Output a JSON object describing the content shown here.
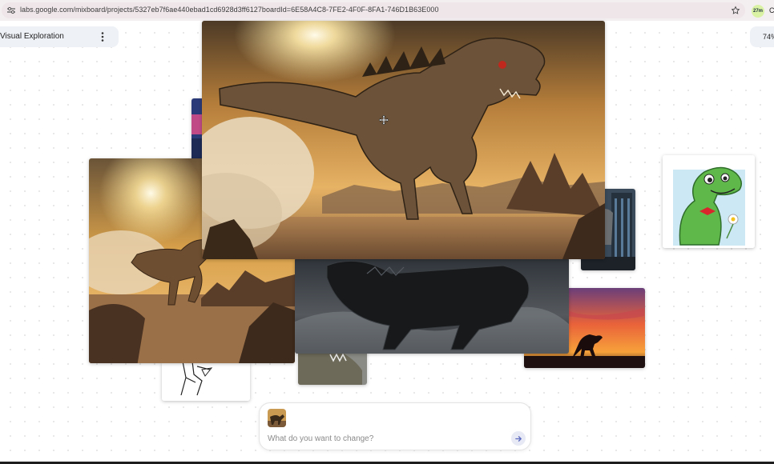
{
  "browser": {
    "url": "labs.google.com/mixboard/projects/5327eb7f6ae440ebad1cd6928d3ff6127boardId=6E58A4C8-7FE2-4F0F-8FA1-746D1B63E000",
    "extension_badge": "27m",
    "edge_char": "C"
  },
  "project": {
    "title": "Visual Exploration"
  },
  "zoom": {
    "level": "74%"
  },
  "prompt": {
    "placeholder": "What do you want to change?"
  },
  "icons": {
    "site_info": "tune-icon",
    "bookmark": "star-icon",
    "menu": "more-vert-icon",
    "submit": "arrow-forward-icon",
    "cursor": "move-cursor-icon"
  },
  "colors": {
    "accent": "#5c6bc0",
    "chip_bg": "#eef1f6",
    "desert_sky": "#d9a14a",
    "night_sky": "#3b3f46",
    "sunset": "#e9623a",
    "cartoon_green": "#5fb84a"
  }
}
